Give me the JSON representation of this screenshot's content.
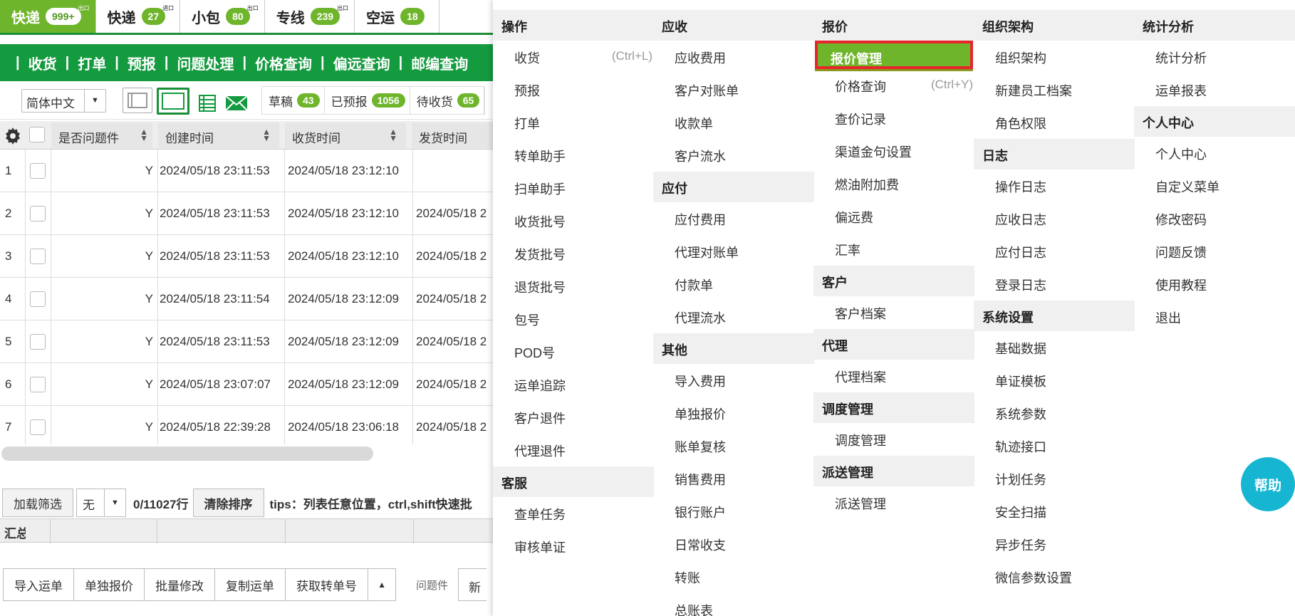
{
  "top_tabs": [
    {
      "label": "快递",
      "count": "999+",
      "badge": "出口",
      "active": true
    },
    {
      "label": "快递",
      "count": "27",
      "badge": "进口",
      "active": false
    },
    {
      "label": "小包",
      "count": "80",
      "badge": "出口",
      "active": false
    },
    {
      "label": "专线",
      "count": "239",
      "badge": "出口",
      "active": false
    },
    {
      "label": "空运",
      "count": "18",
      "badge": "",
      "active": false
    }
  ],
  "nav": {
    "items": [
      "收货",
      "打单",
      "预报",
      "问题处理",
      "价格查询",
      "偏远查询",
      "邮编查询"
    ],
    "separator": "|"
  },
  "toolbar": {
    "language": "简体中文",
    "status_tabs": [
      {
        "label": "草稿",
        "count": "43"
      },
      {
        "label": "已预报",
        "count": "1056"
      },
      {
        "label": "待收货",
        "count": "65"
      }
    ]
  },
  "table": {
    "headers": [
      "是否问题件",
      "创建时间",
      "收货时间",
      "发货时间"
    ],
    "rows": [
      {
        "no": "1",
        "problem": "Y",
        "created": "2024/05/18 23:11:53",
        "received": "2024/05/18 23:12:10",
        "shipped": ""
      },
      {
        "no": "2",
        "problem": "Y",
        "created": "2024/05/18 23:11:53",
        "received": "2024/05/18 23:12:10",
        "shipped": "2024/05/18 2"
      },
      {
        "no": "3",
        "problem": "Y",
        "created": "2024/05/18 23:11:53",
        "received": "2024/05/18 23:12:10",
        "shipped": "2024/05/18 2"
      },
      {
        "no": "4",
        "problem": "Y",
        "created": "2024/05/18 23:11:54",
        "received": "2024/05/18 23:12:09",
        "shipped": "2024/05/18 2"
      },
      {
        "no": "5",
        "problem": "Y",
        "created": "2024/05/18 23:11:53",
        "received": "2024/05/18 23:12:09",
        "shipped": "2024/05/18 2"
      },
      {
        "no": "6",
        "problem": "Y",
        "created": "2024/05/18 23:07:07",
        "received": "2024/05/18 23:12:09",
        "shipped": "2024/05/18 2"
      },
      {
        "no": "7",
        "problem": "Y",
        "created": "2024/05/18 22:39:28",
        "received": "2024/05/18 23:06:18",
        "shipped": "2024/05/18 2"
      }
    ]
  },
  "filter_bar": {
    "load_filter": "加载筛选",
    "select_value": "无",
    "row_count": "0/11027行",
    "clear_sort": "清除排序",
    "tips": "tips：列表任意位置，ctrl,shift快速批"
  },
  "summary": {
    "label": "汇总"
  },
  "bottom_bar": {
    "buttons": [
      "导入运单",
      "单独报价",
      "批量修改",
      "复制运单",
      "获取转单号"
    ],
    "problem_label": "问题件",
    "new_label": "新"
  },
  "menu": {
    "columns": [
      {
        "sections": [
          {
            "title": "操作",
            "items": [
              {
                "label": "收货",
                "shortcut": "(Ctrl+L)"
              },
              {
                "label": "预报"
              },
              {
                "label": "打单"
              },
              {
                "label": "转单助手"
              },
              {
                "label": "扫单助手"
              },
              {
                "label": "收货批号"
              },
              {
                "label": "发货批号"
              },
              {
                "label": "退货批号"
              },
              {
                "label": "包号"
              },
              {
                "label": "POD号"
              },
              {
                "label": "运单追踪"
              },
              {
                "label": "客户退件"
              },
              {
                "label": "代理退件"
              }
            ]
          },
          {
            "title": "客服",
            "items": [
              {
                "label": "查单任务"
              },
              {
                "label": "审核单证"
              }
            ]
          }
        ]
      },
      {
        "sections": [
          {
            "title": "应收",
            "items": [
              {
                "label": "应收费用"
              },
              {
                "label": "客户对账单"
              },
              {
                "label": "收款单"
              },
              {
                "label": "客户流水"
              }
            ]
          },
          {
            "title": "应付",
            "items": [
              {
                "label": "应付费用"
              },
              {
                "label": "代理对账单"
              },
              {
                "label": "付款单"
              },
              {
                "label": "代理流水"
              }
            ]
          },
          {
            "title": "其他",
            "items": [
              {
                "label": "导入费用"
              },
              {
                "label": "单独报价"
              },
              {
                "label": "账单复核"
              },
              {
                "label": "销售费用"
              },
              {
                "label": "银行账户"
              },
              {
                "label": "日常收支"
              },
              {
                "label": "转账"
              },
              {
                "label": "总账表"
              }
            ]
          }
        ]
      },
      {
        "sections": [
          {
            "title": "报价",
            "items": [
              {
                "label": "报价管理",
                "highlighted": true
              },
              {
                "label": "价格查询",
                "shortcut": "(Ctrl+Y)"
              },
              {
                "label": "查价记录"
              },
              {
                "label": "渠道金句设置"
              },
              {
                "label": "燃油附加费"
              },
              {
                "label": "偏远费"
              },
              {
                "label": "汇率"
              }
            ]
          },
          {
            "title": "客户",
            "items": [
              {
                "label": "客户档案"
              }
            ]
          },
          {
            "title": "代理",
            "items": [
              {
                "label": "代理档案"
              }
            ]
          },
          {
            "title": "调度管理",
            "items": [
              {
                "label": "调度管理"
              }
            ]
          },
          {
            "title": "派送管理",
            "items": [
              {
                "label": "派送管理"
              }
            ]
          }
        ]
      },
      {
        "sections": [
          {
            "title": "组织架构",
            "items": [
              {
                "label": "组织架构"
              },
              {
                "label": "新建员工档案"
              },
              {
                "label": "角色权限"
              }
            ]
          },
          {
            "title": "日志",
            "items": [
              {
                "label": "操作日志"
              },
              {
                "label": "应收日志"
              },
              {
                "label": "应付日志"
              },
              {
                "label": "登录日志"
              }
            ]
          },
          {
            "title": "系统设置",
            "items": [
              {
                "label": "基础数据"
              },
              {
                "label": "单证模板"
              },
              {
                "label": "系统参数"
              },
              {
                "label": "轨迹接口"
              },
              {
                "label": "计划任务"
              },
              {
                "label": "安全扫描"
              },
              {
                "label": "异步任务"
              },
              {
                "label": "微信参数设置"
              }
            ]
          }
        ]
      },
      {
        "sections": [
          {
            "title": "统计分析",
            "items": [
              {
                "label": "统计分析"
              },
              {
                "label": "运单报表"
              }
            ]
          },
          {
            "title": "个人中心",
            "items": [
              {
                "label": "个人中心"
              },
              {
                "label": "自定义菜单"
              },
              {
                "label": "修改密码"
              },
              {
                "label": "问题反馈"
              },
              {
                "label": "使用教程"
              },
              {
                "label": "退出"
              }
            ]
          }
        ]
      }
    ]
  },
  "help_button": "帮助",
  "colors": {
    "accent_green": "#6fb52c",
    "nav_green": "#149a3f",
    "help_cyan": "#16b6d2",
    "highlight_border": "#e6262a"
  }
}
